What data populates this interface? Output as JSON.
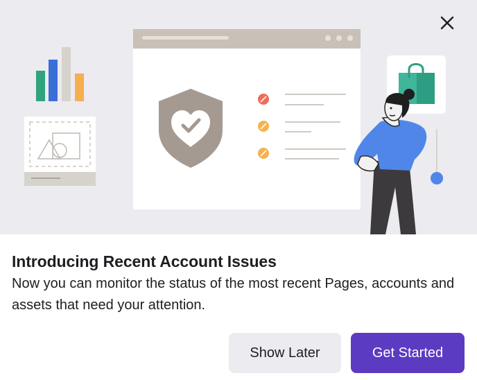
{
  "dialog": {
    "title": "Introducing Recent Account Issues",
    "description": "Now you can monitor the status of the most recent Pages, accounts and assets that need your attention.",
    "secondary_button_label": "Show Later",
    "primary_button_label": "Get Started"
  },
  "icons": {
    "close": "close-icon",
    "shield": "shield-heart-check-icon",
    "shopping_bag": "shopping-bag-icon"
  },
  "colors": {
    "primary_button": "#5b3bc2",
    "secondary_button": "#ebebf0",
    "hero_background": "#ebebf0",
    "text": "#1c1e21"
  }
}
